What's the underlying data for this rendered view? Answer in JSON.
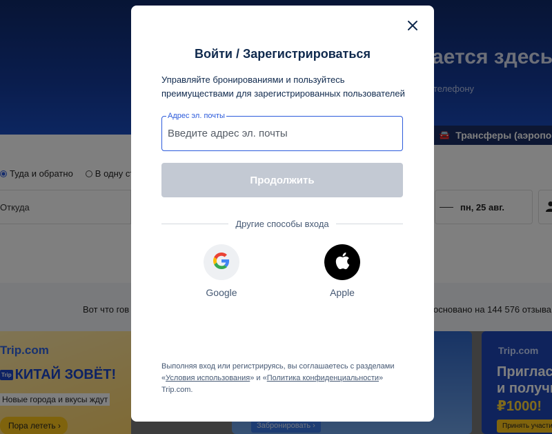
{
  "background": {
    "hero_title": "ается здесь",
    "hero_subtitle": "телефону",
    "transfer_tab": "Трансферы (аэропорт",
    "trip_options": [
      "Туда и обратно",
      "В одну ст"
    ],
    "from_field": "Откуда",
    "date_value": "пн, 25 авг.",
    "reviews_left": "Вот что гов",
    "reviews_right": "основано на 144 576 отзыва",
    "promo1": {
      "brand": "Trip.com",
      "tag": "Trip",
      "headline": "КИТАЙ ЗОВЁТ!",
      "sub": "Новые города и вкусы ждут",
      "button": "Пора лететь"
    },
    "promo2": {
      "button": "Забронировать"
    },
    "promo3": {
      "brand": "Trip.com",
      "line1": "Приглас",
      "line2": "и получи",
      "line3": "₽1000!",
      "button": "Принять участи"
    }
  },
  "modal": {
    "title": "Войти / Зарегистрироваться",
    "description": "Управляйте бронированиями и пользуйтесь преимуществами для зарегистрированных пользователей",
    "email": {
      "label": "Адрес эл. почты",
      "placeholder": "Введите адрес эл. почты",
      "value": ""
    },
    "continue_label": "Продолжить",
    "divider_text": "Другие способы входа",
    "social": [
      {
        "label": "Google",
        "icon": "google-icon"
      },
      {
        "label": "Apple",
        "icon": "apple-icon"
      }
    ],
    "terms": {
      "prefix": "Выполняя вход или регистрируясь, вы соглашаетесь с разделами «",
      "terms_link": "Условия использования",
      "middle": "» и «",
      "privacy_link": "Политика конфиденциальности",
      "suffix": "» Trip.com."
    }
  },
  "colors": {
    "accent": "#2b5adb",
    "title_text": "#0f294d",
    "disabled_button": "#c3c9d3"
  }
}
